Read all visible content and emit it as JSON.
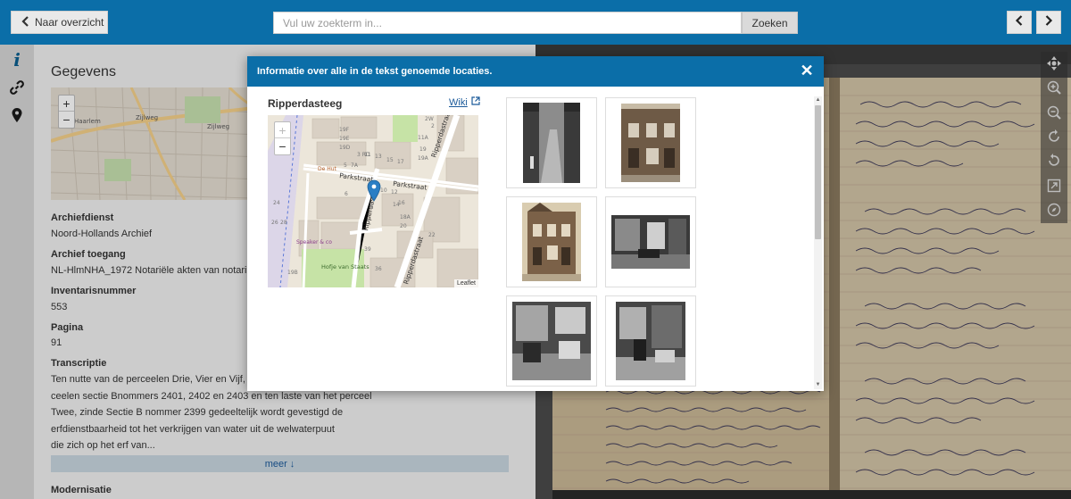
{
  "topbar": {
    "back_label": "Naar overzicht",
    "search_placeholder": "Vul uw zoekterm in...",
    "search_button": "Zoeken"
  },
  "left_panel": {
    "title": "Gegevens",
    "fields": [
      {
        "label": "Archiefdienst",
        "value": "Noord-Hollands Archief"
      },
      {
        "label": "Archief toegang",
        "value": "NL-HlmNHA_1972 Notariële akten van notari"
      },
      {
        "label": "Inventarisnummer",
        "value": "553"
      },
      {
        "label": "Pagina",
        "value": "91"
      }
    ],
    "transcript_label": "Transcriptie",
    "transcript_lines": [
      "Ten nutte van de perceelen Drie, Vier en Vijf, z",
      "ceelen sectie Bnommers 2401, 2402 en 2403 en ten laste van het perceel",
      "Twee, zinde Sectie B nommer 2399 gedeeltelijk wordt gevestigd de",
      "erfdienstbaarheid tot het verkrijgen van water uit de welwaterpuut",
      "die zich op het erf van..."
    ],
    "more_label": "meer ↓",
    "next_label": "Modernisatie",
    "map_labels": {
      "street1": "Zijlweg",
      "street2": "Zijlweg",
      "area": "Haarlem"
    }
  },
  "modal": {
    "title": "Informatie over alle in de tekst genoemde locaties.",
    "location_name": "Ripperdasteeg",
    "wiki_label": "Wiki",
    "map_labels": {
      "parkstraat": "Parkstraat",
      "ripperdasteeg": "Ripperdasteeg",
      "ripperdastraat": "Ripperdastraat",
      "hofje": "Hofje van Staats",
      "dehut": "De Hut",
      "speaker": "Speaker & co",
      "leaflet": "Leaflet",
      "numbers": [
        "2W",
        "2",
        "19F",
        "19E",
        "19D",
        "3 RD",
        "5",
        "7A",
        "11",
        "13",
        "15",
        "17",
        "19A",
        "19",
        "24",
        "26",
        "28",
        "6",
        "8",
        "10",
        "12",
        "14",
        "16",
        "18A",
        "20",
        "22",
        "11A",
        "19B",
        "39",
        "36",
        "30 RD"
      ]
    },
    "photo_count": 6
  },
  "colors": {
    "primary": "#0b6ea8",
    "panel_bg": "#f0f0f0",
    "link": "#1b5a9a"
  },
  "icons": {
    "info": "info-icon",
    "link": "link-icon",
    "location": "map-marker-icon",
    "close": "close-icon"
  }
}
